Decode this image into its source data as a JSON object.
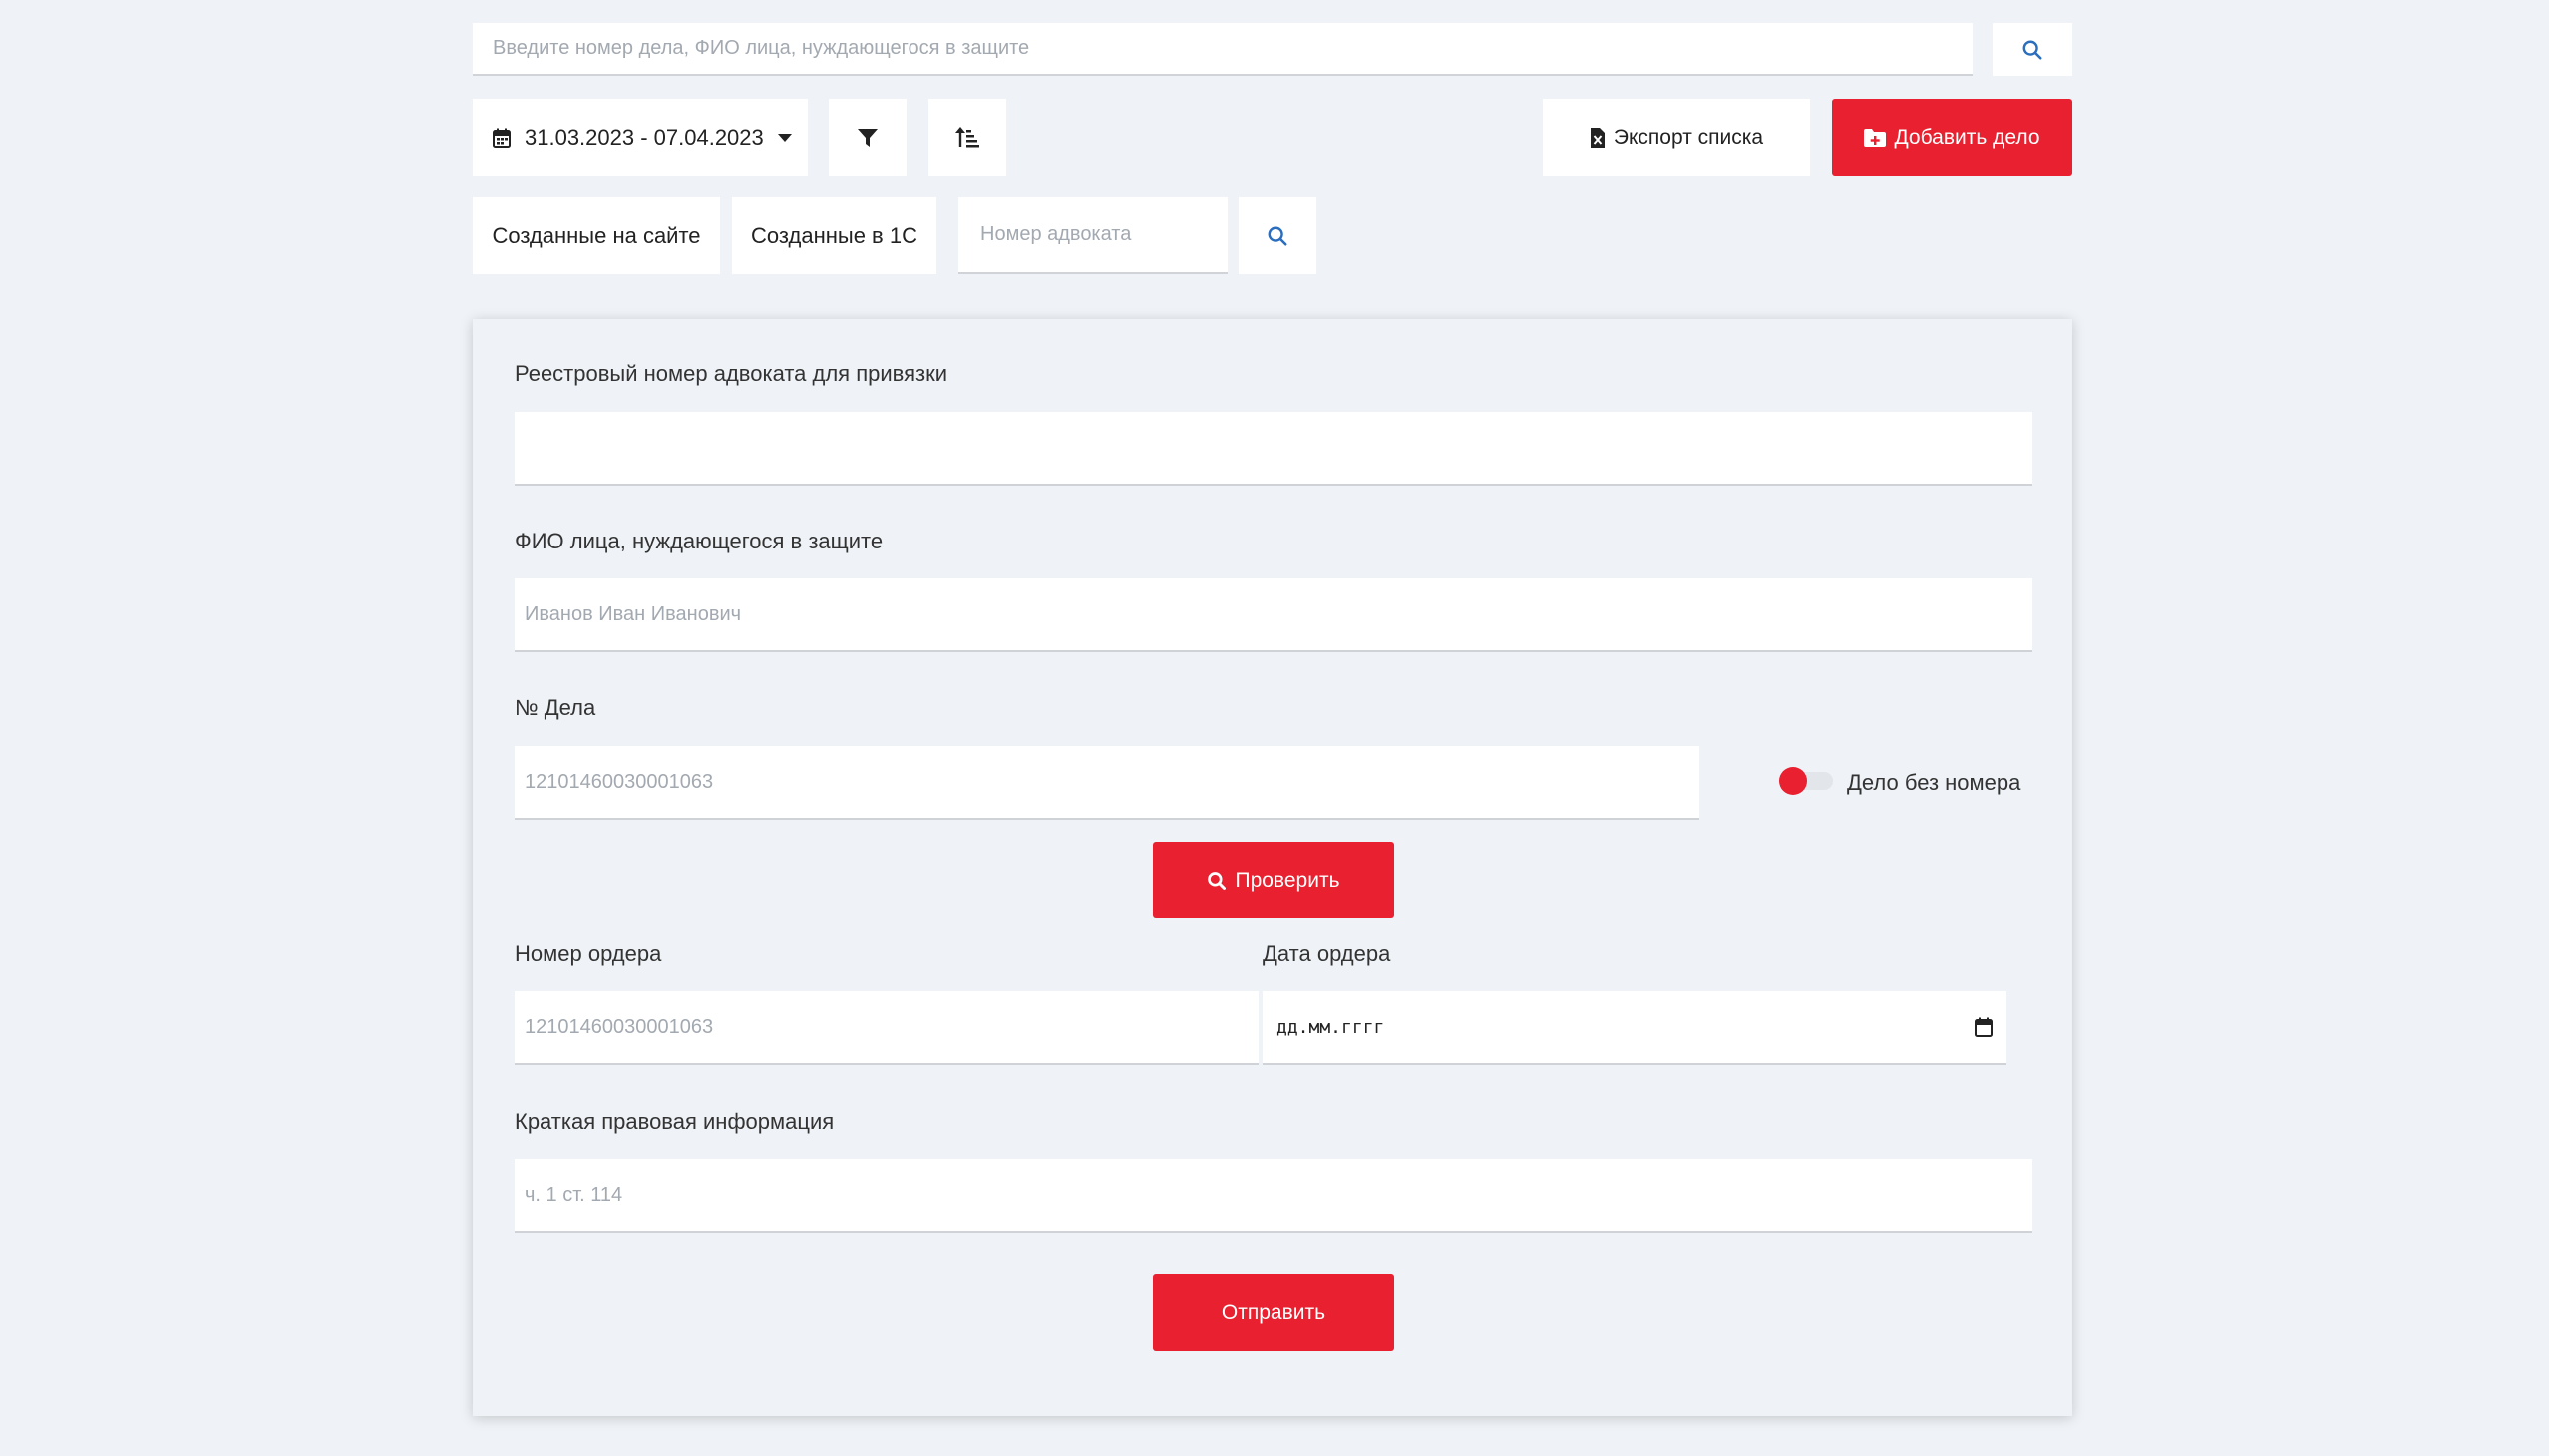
{
  "search": {
    "placeholder": "Введите номер дела, ФИО лица, нуждающегося в защите"
  },
  "toolbar": {
    "date_range": "31.03.2023 - 07.04.2023",
    "export_label": "Экспорт списка",
    "add_label": "Добавить дело"
  },
  "filters": {
    "tab_site": "Созданные на сайте",
    "tab_1c": "Созданные в 1С",
    "lawyer_placeholder": "Номер адвоката"
  },
  "form": {
    "registry_label": "Реестровый номер адвоката для привязки",
    "registry_value": "",
    "fio_label": "ФИО лица, нуждающегося в защите",
    "fio_placeholder": "Иванов Иван Иванович",
    "case_label": "№ Дела",
    "case_placeholder": "12101460030001063",
    "no_number_label": "Дело без номера",
    "check_label": "Проверить",
    "order_number_label": "Номер ордера",
    "order_number_placeholder": "12101460030001063",
    "order_date_label": "Дата ордера",
    "order_date_placeholder": "дд.мм.гггг",
    "legal_info_label": "Краткая правовая информация",
    "legal_info_placeholder": "ч. 1 ст. 114",
    "submit_label": "Отправить"
  },
  "colors": {
    "accent": "#e8202f",
    "background": "#eff3f7",
    "icon_blue": "#2a6ebd"
  }
}
